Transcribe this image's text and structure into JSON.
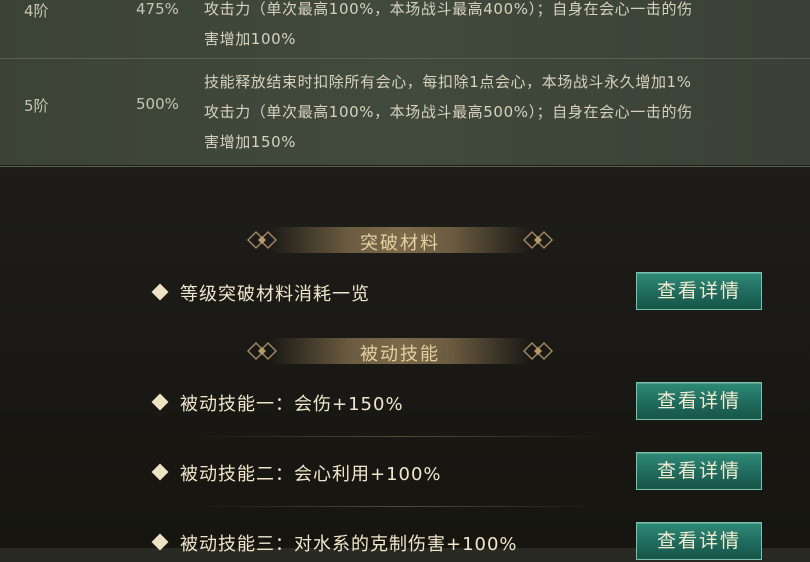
{
  "table": {
    "rows": [
      {
        "level": "4阶",
        "pct": "475%",
        "desc": [
          "攻击力（单次最高100%，本场战斗最高400%）；自身在会心一击的伤",
          "害增加100%"
        ]
      },
      {
        "level": "5阶",
        "pct": "500%",
        "desc": [
          "技能释放结束时扣除所有会心，每扣除1点会心，本场战斗永久增加1%",
          "攻击力（单次最高100%，本场战斗最高500%）；自身在会心一击的伤",
          "害增加150%"
        ]
      }
    ]
  },
  "sections": {
    "breakthrough": {
      "title": "突破材料",
      "items": [
        {
          "label": "等级突破材料消耗一览",
          "button": "查看详情"
        }
      ]
    },
    "passive": {
      "title": "被动技能",
      "items": [
        {
          "label": "被动技能一：会伤+150%",
          "button": "查看详情"
        },
        {
          "label": "被动技能二：会心利用+100%",
          "button": "查看详情"
        },
        {
          "label": "被动技能三：对水系的克制伤害+100%",
          "button": "查看详情"
        }
      ]
    }
  },
  "colors": {
    "button": "#1f6b5d",
    "banner": "#8c7652",
    "text": "#f0e6cc"
  }
}
